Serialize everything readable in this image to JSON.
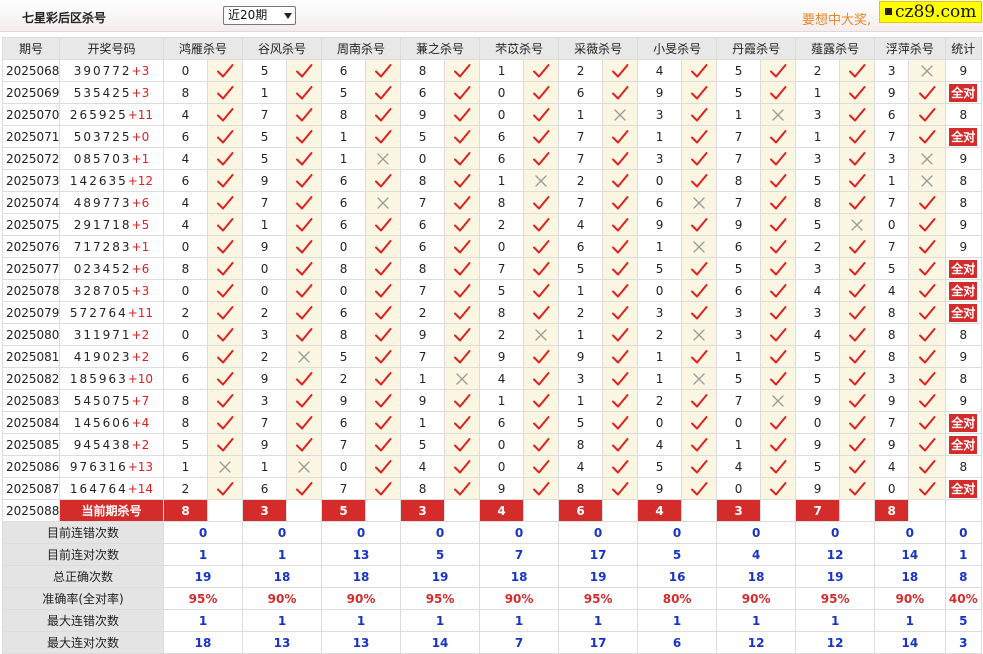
{
  "header": {
    "title": "七星彩后区杀号",
    "period_select": "近20期",
    "promo": "要想中大奖,",
    "brand": "cz89.com"
  },
  "table": {
    "headers": [
      "期号",
      "开奖号码",
      "鸿雁杀号",
      "谷风杀号",
      "周南杀号",
      "蒹之杀号",
      "芣苡杀号",
      "采薇杀号",
      "小旻杀号",
      "丹霞杀号",
      "薤露杀号",
      "浮萍杀号",
      "统计"
    ],
    "rows": [
      {
        "period": "2025068",
        "draw": "390772",
        "plus": "+3",
        "kills": [
          [
            "0",
            "y"
          ],
          [
            "5",
            "y"
          ],
          [
            "6",
            "y"
          ],
          [
            "8",
            "y"
          ],
          [
            "1",
            "y"
          ],
          [
            "2",
            "y"
          ],
          [
            "4",
            "y"
          ],
          [
            "5",
            "y"
          ],
          [
            "2",
            "y"
          ],
          [
            "3",
            "n"
          ]
        ],
        "stat": "9"
      },
      {
        "period": "2025069",
        "draw": "535425",
        "plus": "+3",
        "kills": [
          [
            "8",
            "y"
          ],
          [
            "1",
            "y"
          ],
          [
            "5",
            "y"
          ],
          [
            "6",
            "y"
          ],
          [
            "0",
            "y"
          ],
          [
            "6",
            "y"
          ],
          [
            "9",
            "y"
          ],
          [
            "5",
            "y"
          ],
          [
            "1",
            "y"
          ],
          [
            "9",
            "y"
          ]
        ],
        "stat": "全对"
      },
      {
        "period": "2025070",
        "draw": "265925",
        "plus": "+11",
        "kills": [
          [
            "4",
            "y"
          ],
          [
            "7",
            "y"
          ],
          [
            "8",
            "y"
          ],
          [
            "9",
            "y"
          ],
          [
            "0",
            "y"
          ],
          [
            "1",
            "n"
          ],
          [
            "3",
            "y"
          ],
          [
            "1",
            "n"
          ],
          [
            "3",
            "y"
          ],
          [
            "6",
            "y"
          ]
        ],
        "stat": "8"
      },
      {
        "period": "2025071",
        "draw": "503725",
        "plus": "+0",
        "kills": [
          [
            "6",
            "y"
          ],
          [
            "5",
            "y"
          ],
          [
            "1",
            "y"
          ],
          [
            "5",
            "y"
          ],
          [
            "6",
            "y"
          ],
          [
            "7",
            "y"
          ],
          [
            "1",
            "y"
          ],
          [
            "7",
            "y"
          ],
          [
            "1",
            "y"
          ],
          [
            "7",
            "y"
          ]
        ],
        "stat": "全对"
      },
      {
        "period": "2025072",
        "draw": "085703",
        "plus": "+1",
        "kills": [
          [
            "4",
            "y"
          ],
          [
            "5",
            "y"
          ],
          [
            "1",
            "n"
          ],
          [
            "0",
            "y"
          ],
          [
            "6",
            "y"
          ],
          [
            "7",
            "y"
          ],
          [
            "3",
            "y"
          ],
          [
            "7",
            "y"
          ],
          [
            "3",
            "y"
          ],
          [
            "3",
            "n"
          ]
        ],
        "stat": "9"
      },
      {
        "period": "2025073",
        "draw": "142635",
        "plus": "+12",
        "kills": [
          [
            "6",
            "y"
          ],
          [
            "9",
            "y"
          ],
          [
            "6",
            "y"
          ],
          [
            "8",
            "y"
          ],
          [
            "1",
            "n"
          ],
          [
            "2",
            "y"
          ],
          [
            "0",
            "y"
          ],
          [
            "8",
            "y"
          ],
          [
            "5",
            "y"
          ],
          [
            "1",
            "n"
          ]
        ],
        "stat": "8"
      },
      {
        "period": "2025074",
        "draw": "489773",
        "plus": "+6",
        "kills": [
          [
            "4",
            "y"
          ],
          [
            "7",
            "y"
          ],
          [
            "6",
            "n"
          ],
          [
            "7",
            "y"
          ],
          [
            "8",
            "y"
          ],
          [
            "7",
            "y"
          ],
          [
            "6",
            "n"
          ],
          [
            "7",
            "y"
          ],
          [
            "8",
            "y"
          ],
          [
            "7",
            "y"
          ]
        ],
        "stat": "8"
      },
      {
        "period": "2025075",
        "draw": "291718",
        "plus": "+5",
        "kills": [
          [
            "4",
            "y"
          ],
          [
            "1",
            "y"
          ],
          [
            "6",
            "y"
          ],
          [
            "6",
            "y"
          ],
          [
            "2",
            "y"
          ],
          [
            "4",
            "y"
          ],
          [
            "9",
            "y"
          ],
          [
            "9",
            "y"
          ],
          [
            "5",
            "n"
          ],
          [
            "0",
            "y"
          ]
        ],
        "stat": "9"
      },
      {
        "period": "2025076",
        "draw": "717283",
        "plus": "+1",
        "kills": [
          [
            "0",
            "y"
          ],
          [
            "9",
            "y"
          ],
          [
            "0",
            "y"
          ],
          [
            "6",
            "y"
          ],
          [
            "0",
            "y"
          ],
          [
            "6",
            "y"
          ],
          [
            "1",
            "n"
          ],
          [
            "6",
            "y"
          ],
          [
            "2",
            "y"
          ],
          [
            "7",
            "y"
          ]
        ],
        "stat": "9"
      },
      {
        "period": "2025077",
        "draw": "023452",
        "plus": "+6",
        "kills": [
          [
            "8",
            "y"
          ],
          [
            "0",
            "y"
          ],
          [
            "8",
            "y"
          ],
          [
            "8",
            "y"
          ],
          [
            "7",
            "y"
          ],
          [
            "5",
            "y"
          ],
          [
            "5",
            "y"
          ],
          [
            "5",
            "y"
          ],
          [
            "3",
            "y"
          ],
          [
            "5",
            "y"
          ]
        ],
        "stat": "全对"
      },
      {
        "period": "2025078",
        "draw": "328705",
        "plus": "+3",
        "kills": [
          [
            "0",
            "y"
          ],
          [
            "0",
            "y"
          ],
          [
            "0",
            "y"
          ],
          [
            "7",
            "y"
          ],
          [
            "5",
            "y"
          ],
          [
            "1",
            "y"
          ],
          [
            "0",
            "y"
          ],
          [
            "6",
            "y"
          ],
          [
            "4",
            "y"
          ],
          [
            "4",
            "y"
          ]
        ],
        "stat": "全对"
      },
      {
        "period": "2025079",
        "draw": "572764",
        "plus": "+11",
        "kills": [
          [
            "2",
            "y"
          ],
          [
            "2",
            "y"
          ],
          [
            "6",
            "y"
          ],
          [
            "2",
            "y"
          ],
          [
            "8",
            "y"
          ],
          [
            "2",
            "y"
          ],
          [
            "3",
            "y"
          ],
          [
            "3",
            "y"
          ],
          [
            "3",
            "y"
          ],
          [
            "8",
            "y"
          ]
        ],
        "stat": "全对"
      },
      {
        "period": "2025080",
        "draw": "311971",
        "plus": "+2",
        "kills": [
          [
            "0",
            "y"
          ],
          [
            "3",
            "y"
          ],
          [
            "8",
            "y"
          ],
          [
            "9",
            "y"
          ],
          [
            "2",
            "n"
          ],
          [
            "1",
            "y"
          ],
          [
            "2",
            "n"
          ],
          [
            "3",
            "y"
          ],
          [
            "4",
            "y"
          ],
          [
            "8",
            "y"
          ]
        ],
        "stat": "8"
      },
      {
        "period": "2025081",
        "draw": "419023",
        "plus": "+2",
        "kills": [
          [
            "6",
            "y"
          ],
          [
            "2",
            "n"
          ],
          [
            "5",
            "y"
          ],
          [
            "7",
            "y"
          ],
          [
            "9",
            "y"
          ],
          [
            "9",
            "y"
          ],
          [
            "1",
            "y"
          ],
          [
            "1",
            "y"
          ],
          [
            "5",
            "y"
          ],
          [
            "8",
            "y"
          ]
        ],
        "stat": "9"
      },
      {
        "period": "2025082",
        "draw": "185963",
        "plus": "+10",
        "kills": [
          [
            "6",
            "y"
          ],
          [
            "9",
            "y"
          ],
          [
            "2",
            "y"
          ],
          [
            "1",
            "n"
          ],
          [
            "4",
            "y"
          ],
          [
            "3",
            "y"
          ],
          [
            "1",
            "n"
          ],
          [
            "5",
            "y"
          ],
          [
            "5",
            "y"
          ],
          [
            "3",
            "y"
          ]
        ],
        "stat": "8"
      },
      {
        "period": "2025083",
        "draw": "545075",
        "plus": "+7",
        "kills": [
          [
            "8",
            "y"
          ],
          [
            "3",
            "y"
          ],
          [
            "9",
            "y"
          ],
          [
            "9",
            "y"
          ],
          [
            "1",
            "y"
          ],
          [
            "1",
            "y"
          ],
          [
            "2",
            "y"
          ],
          [
            "7",
            "n"
          ],
          [
            "9",
            "y"
          ],
          [
            "9",
            "y"
          ]
        ],
        "stat": "9"
      },
      {
        "period": "2025084",
        "draw": "145606",
        "plus": "+4",
        "kills": [
          [
            "8",
            "y"
          ],
          [
            "7",
            "y"
          ],
          [
            "6",
            "y"
          ],
          [
            "1",
            "y"
          ],
          [
            "6",
            "y"
          ],
          [
            "5",
            "y"
          ],
          [
            "0",
            "y"
          ],
          [
            "0",
            "y"
          ],
          [
            "0",
            "y"
          ],
          [
            "7",
            "y"
          ]
        ],
        "stat": "全对"
      },
      {
        "period": "2025085",
        "draw": "945438",
        "plus": "+2",
        "kills": [
          [
            "5",
            "y"
          ],
          [
            "9",
            "y"
          ],
          [
            "7",
            "y"
          ],
          [
            "5",
            "y"
          ],
          [
            "0",
            "y"
          ],
          [
            "8",
            "y"
          ],
          [
            "4",
            "y"
          ],
          [
            "1",
            "y"
          ],
          [
            "9",
            "y"
          ],
          [
            "9",
            "y"
          ]
        ],
        "stat": "全对"
      },
      {
        "period": "2025086",
        "draw": "976316",
        "plus": "+13",
        "kills": [
          [
            "1",
            "n"
          ],
          [
            "1",
            "n"
          ],
          [
            "0",
            "y"
          ],
          [
            "4",
            "y"
          ],
          [
            "0",
            "y"
          ],
          [
            "4",
            "y"
          ],
          [
            "5",
            "y"
          ],
          [
            "4",
            "y"
          ],
          [
            "5",
            "y"
          ],
          [
            "4",
            "y"
          ]
        ],
        "stat": "8"
      },
      {
        "period": "2025087",
        "draw": "164764",
        "plus": "+14",
        "kills": [
          [
            "2",
            "y"
          ],
          [
            "6",
            "y"
          ],
          [
            "7",
            "y"
          ],
          [
            "8",
            "y"
          ],
          [
            "9",
            "y"
          ],
          [
            "8",
            "y"
          ],
          [
            "9",
            "y"
          ],
          [
            "0",
            "y"
          ],
          [
            "9",
            "y"
          ],
          [
            "0",
            "y"
          ]
        ],
        "stat": "全对"
      }
    ],
    "current": {
      "period": "2025088",
      "label": "当前期杀号",
      "kills": [
        "8",
        "3",
        "5",
        "3",
        "4",
        "6",
        "4",
        "3",
        "7",
        "8"
      ]
    },
    "stats": [
      {
        "label": "目前连错次数",
        "values": [
          "0",
          "0",
          "0",
          "0",
          "0",
          "0",
          "0",
          "0",
          "0",
          "0"
        ],
        "total": "0"
      },
      {
        "label": "目前连对次数",
        "values": [
          "1",
          "1",
          "13",
          "5",
          "7",
          "17",
          "5",
          "4",
          "12",
          "14"
        ],
        "total": "1"
      },
      {
        "label": "总正确次数",
        "values": [
          "19",
          "18",
          "18",
          "19",
          "18",
          "19",
          "16",
          "18",
          "19",
          "18"
        ],
        "total": "8"
      },
      {
        "label": "准确率(全对率)",
        "values": [
          "95%",
          "90%",
          "90%",
          "95%",
          "90%",
          "95%",
          "80%",
          "90%",
          "95%",
          "90%"
        ],
        "total": "40%",
        "pct": true
      },
      {
        "label": "最大连错次数",
        "values": [
          "1",
          "1",
          "1",
          "1",
          "1",
          "1",
          "1",
          "1",
          "1",
          "1"
        ],
        "total": "5"
      },
      {
        "label": "最大连对次数",
        "values": [
          "18",
          "13",
          "13",
          "14",
          "7",
          "17",
          "6",
          "12",
          "12",
          "14"
        ],
        "total": "3"
      }
    ]
  },
  "colors": {
    "accent_red": "#d42b2b",
    "check_red": "#e02020",
    "cross_gray": "#9a9a9a",
    "stat_blue": "#1733c8",
    "promo_orange": "#e8862a",
    "brand_yellow": "#ffff00"
  },
  "icons": {
    "correct": "check-icon",
    "wrong": "cross-icon"
  }
}
